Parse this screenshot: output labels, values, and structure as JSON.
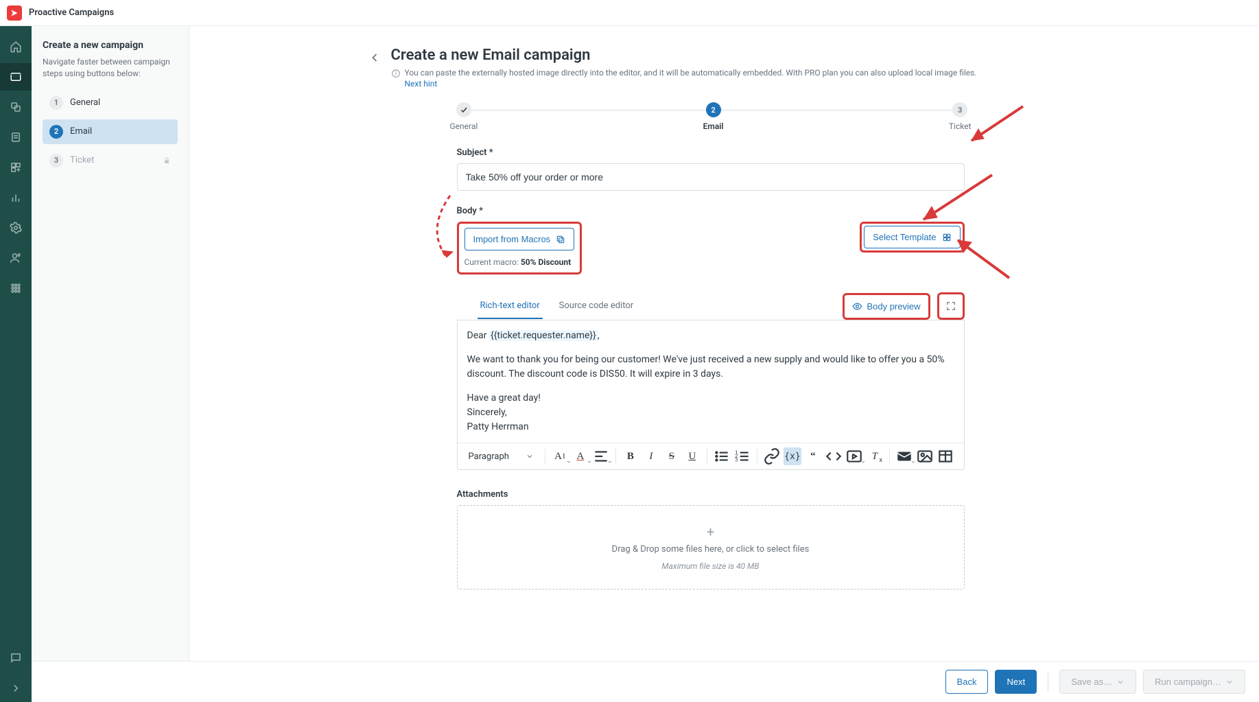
{
  "header": {
    "app_title": "Proactive Campaigns"
  },
  "rail": {
    "items": [
      {
        "name": "home-icon",
        "label": "Home"
      },
      {
        "name": "mail-icon",
        "label": "Campaigns",
        "active": true
      },
      {
        "name": "copy-icon",
        "label": "Templates"
      },
      {
        "name": "list-icon",
        "label": "Lists"
      },
      {
        "name": "widgets-icon",
        "label": "Views"
      },
      {
        "name": "chart-icon",
        "label": "Analytics"
      },
      {
        "name": "gear-icon",
        "label": "Settings"
      },
      {
        "name": "user-lock-icon",
        "label": "Agents"
      },
      {
        "name": "apps-icon",
        "label": "Apps"
      }
    ],
    "bottom": [
      {
        "name": "chat-icon",
        "label": "Chat"
      },
      {
        "name": "chevron-right-icon",
        "label": "Expand"
      }
    ]
  },
  "sidepanel": {
    "title": "Create a new campaign",
    "desc": "Navigate faster between campaign steps using buttons below:",
    "steps": [
      {
        "num": "1",
        "label": "General",
        "state": "done"
      },
      {
        "num": "2",
        "label": "Email",
        "state": "active"
      },
      {
        "num": "3",
        "label": "Ticket",
        "state": "disabled",
        "locked": true
      }
    ]
  },
  "page": {
    "title": "Create a new Email campaign",
    "hint": "You can paste the externally hosted image directly into the editor, and it will be automatically embedded. With PRO plan you can also upload local image files.",
    "next_hint": "Next hint"
  },
  "stepper": [
    {
      "label": "General",
      "state": "done",
      "icon": "check"
    },
    {
      "label": "Email",
      "state": "curr",
      "num": "2"
    },
    {
      "label": "Ticket",
      "state": "future",
      "num": "3"
    }
  ],
  "form": {
    "subject_label": "Subject *",
    "subject_value": "Take 50% off your order or more",
    "body_label": "Body *",
    "import_macros": "Import from Macros",
    "current_macro_label": "Current macro: ",
    "current_macro_value": "50% Discount",
    "select_template": "Select Template",
    "richtext_tab": "Rich-text editor",
    "source_tab": "Source code editor",
    "body_preview": "Body preview",
    "body_lines": {
      "greeting_prefix": "Dear ",
      "placeholder": "{{ticket.requester.name}}",
      "greeting_suffix": ",",
      "p1": "We want to thank you for being our customer! We've just received a new supply and would like to offer you a 50% discount. The discount code is DIS50. It will expire in 3 days.",
      "p2": "Have a great day!",
      "p3": "Sincerely,",
      "p4": "Patty Herrman"
    },
    "paragraph_sel": "Paragraph",
    "attachments_label": "Attachments",
    "dropzone_text": "Drag & Drop some files here, or click to select files",
    "dropzone_max": "Maximum file size is 40 MB"
  },
  "footer": {
    "back": "Back",
    "next": "Next",
    "save_as": "Save as…",
    "run": "Run campaign…"
  }
}
